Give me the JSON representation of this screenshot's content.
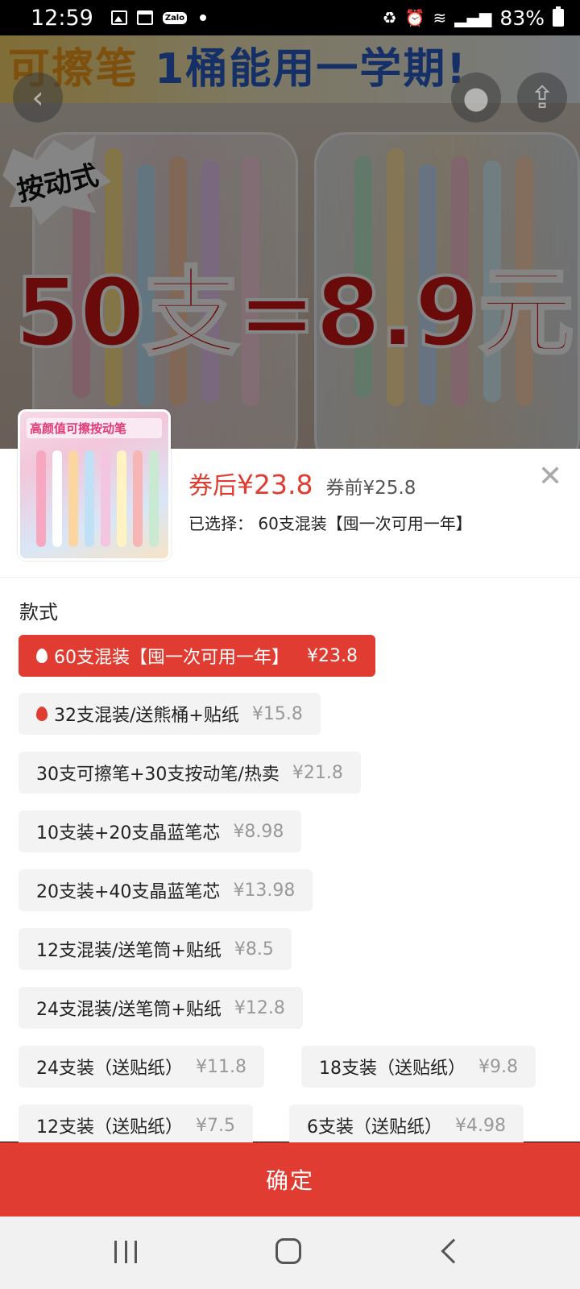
{
  "status_bar": {
    "time": "12:59",
    "zalo_label": "Zalo",
    "battery_percent": "83%"
  },
  "hero": {
    "banner_text_left": "可擦笔",
    "banner_text_right": "1桶能用一学期!",
    "burst_label": "按动式",
    "promo_text": "50支=8.9元"
  },
  "product": {
    "thumb_title": "高颜值可擦按动笔",
    "price_after_label": "券后",
    "price_after_value": "¥23.8",
    "price_before": "券前¥25.8",
    "selected_text": "已选择：  60支混装【囤一次可用一年】",
    "close_symbol": "✕"
  },
  "options_section": {
    "title": "款式",
    "options": [
      {
        "label": "60支混装【囤一次可用一年】",
        "price": "¥23.8",
        "selected": true,
        "hot": true
      },
      {
        "label": "32支混装/送熊桶+贴纸",
        "price": "¥15.8",
        "selected": false,
        "hot": true
      },
      {
        "label": "30支可擦笔+30支按动笔/热卖",
        "price": "¥21.8",
        "selected": false,
        "hot": false
      },
      {
        "label": "10支装+20支晶蓝笔芯",
        "price": "¥8.98",
        "selected": false,
        "hot": false
      },
      {
        "label": "20支装+40支晶蓝笔芯",
        "price": "¥13.98",
        "selected": false,
        "hot": false
      },
      {
        "label": "12支混装/送笔筒+贴纸",
        "price": "¥8.5",
        "selected": false,
        "hot": false
      },
      {
        "label": "24支混装/送笔筒+贴纸",
        "price": "¥12.8",
        "selected": false,
        "hot": false
      },
      {
        "label": "24支装（送贴纸）",
        "price": "¥11.8",
        "selected": false,
        "hot": false
      },
      {
        "label": "18支装（送贴纸）",
        "price": "¥9.8",
        "selected": false,
        "hot": false
      },
      {
        "label": "12支装（送贴纸）",
        "price": "¥7.5",
        "selected": false,
        "hot": false
      },
      {
        "label": "6支装（送贴纸）",
        "price": "¥4.98",
        "selected": false,
        "hot": false
      }
    ]
  },
  "confirm_label": "确定",
  "colors": {
    "accent": "#e03c31",
    "option_bg": "#f3f3f3",
    "price_muted": "#999999"
  },
  "icons": [
    "back-arrow-icon",
    "cart-icon",
    "share-icon",
    "close-icon",
    "flame-icon",
    "recent-apps-icon",
    "home-icon",
    "nav-back-icon"
  ]
}
